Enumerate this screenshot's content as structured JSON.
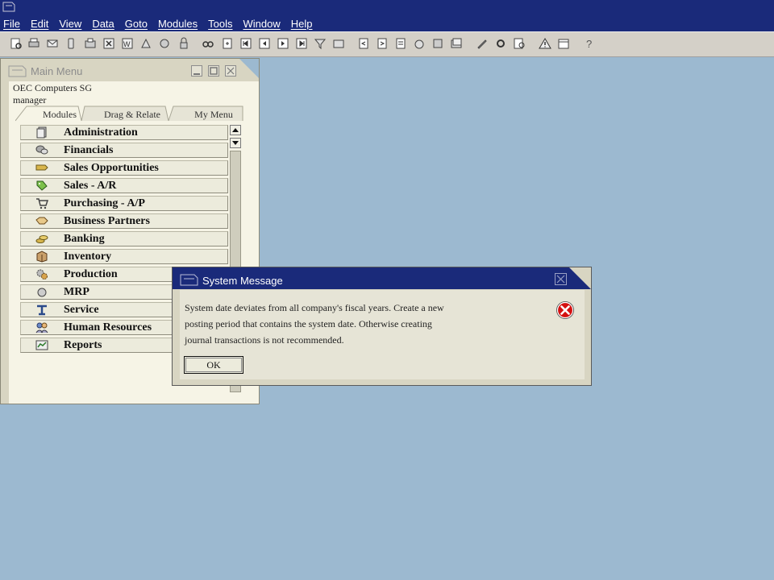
{
  "menubar": [
    "File",
    "Edit",
    "View",
    "Data",
    "Goto",
    "Modules",
    "Tools",
    "Window",
    "Help"
  ],
  "main_menu": {
    "title": "Main Menu",
    "company": "OEC Computers SG",
    "user": "manager",
    "tabs": [
      "Modules",
      "Drag & Relate",
      "My Menu"
    ],
    "items": [
      {
        "label": "Administration",
        "icon": "administration-icon"
      },
      {
        "label": "Financials",
        "icon": "financials-icon"
      },
      {
        "label": "Sales Opportunities",
        "icon": "sales-opportunities-icon"
      },
      {
        "label": "Sales - A/R",
        "icon": "sales-ar-icon"
      },
      {
        "label": "Purchasing - A/P",
        "icon": "purchasing-ap-icon"
      },
      {
        "label": "Business Partners",
        "icon": "business-partners-icon"
      },
      {
        "label": "Banking",
        "icon": "banking-icon"
      },
      {
        "label": "Inventory",
        "icon": "inventory-icon"
      },
      {
        "label": "Production",
        "icon": "production-icon"
      },
      {
        "label": "MRP",
        "icon": "mrp-icon"
      },
      {
        "label": "Service",
        "icon": "service-icon"
      },
      {
        "label": "Human Resources",
        "icon": "human-resources-icon"
      },
      {
        "label": "Reports",
        "icon": "reports-icon"
      }
    ]
  },
  "dialog": {
    "title": "System Message",
    "message_lines": [
      "System date deviates from all company's fiscal years. Create a new",
      "posting period that contains the system date. Otherwise creating",
      "journal transactions is not recommended."
    ],
    "ok_label": "OK"
  },
  "colors": {
    "desktop": "#9cb9d0",
    "titlebar": "#1a2a7a",
    "error": "#cc0000"
  }
}
